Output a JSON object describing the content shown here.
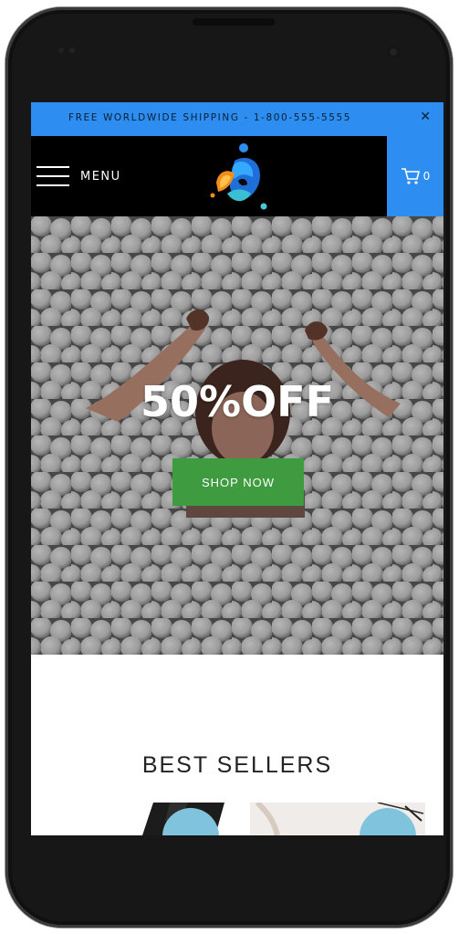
{
  "promo": {
    "text": "FREE WORLDWIDE SHIPPING - 1-800-555-5555",
    "close_symbol": "✕"
  },
  "header": {
    "menu_label": "MENU",
    "cart_count": "0",
    "cart_icon": "cart-icon",
    "logo_icon": "brand-logo"
  },
  "hero": {
    "headline": "50%OFF",
    "cta_label": "SHOP NOW"
  },
  "best_sellers": {
    "title": "BEST SELLERS"
  },
  "colors": {
    "accent_blue": "#2e8df0",
    "cta_green": "#3f9b3f",
    "header_black": "#000000",
    "badge_blue": "#7fc4dc"
  }
}
